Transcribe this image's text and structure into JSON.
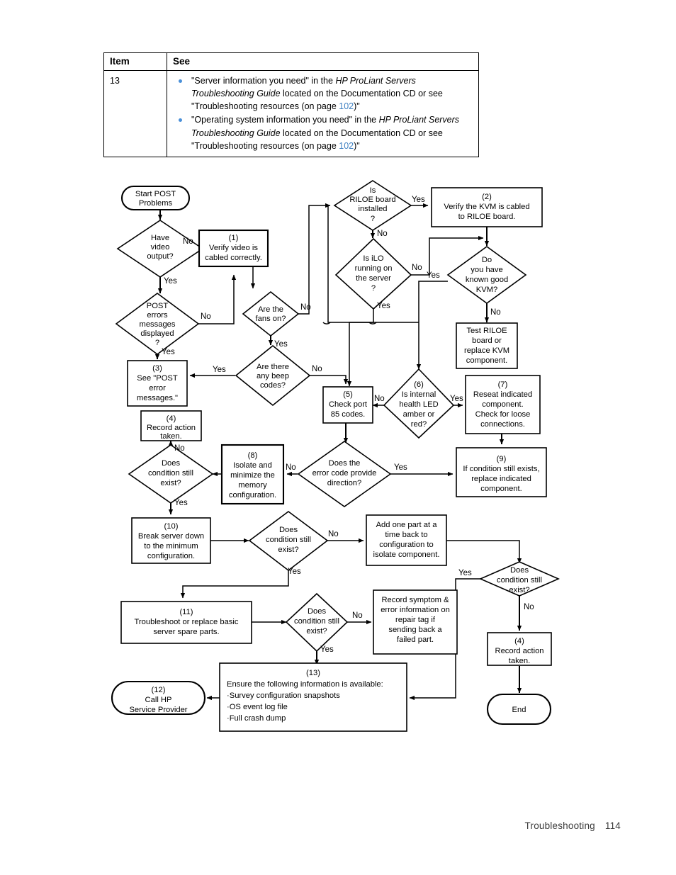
{
  "table": {
    "headers": {
      "item": "Item",
      "see": "See"
    },
    "rows": [
      {
        "item": "13",
        "bullets": [
          {
            "pre": "\"Server information you need\" in the ",
            "italic": "HP ProLiant Servers Troubleshooting Guide",
            "mid": " located on the Documentation CD or see \"Troubleshooting resources (on page ",
            "link": "102",
            "post": ")\""
          },
          {
            "pre": "\"Operating system information you need\" in the ",
            "italic": "HP ProLiant Servers Troubleshooting Guide",
            "mid": " located on the Documentation CD or see \"Troubleshooting resources (on page ",
            "link": "102",
            "post": ")\""
          }
        ]
      }
    ]
  },
  "flowchart": {
    "title": "POST problems troubleshooting flowchart",
    "nodes": {
      "start": {
        "shape": "terminator",
        "lines": [
          "Start POST",
          "Problems"
        ]
      },
      "have_video": {
        "shape": "decision",
        "lines": [
          "Have",
          "video",
          "output?"
        ]
      },
      "post_errors": {
        "shape": "decision",
        "lines": [
          "POST",
          "errors",
          "messages",
          "displayed",
          "?"
        ]
      },
      "box1": {
        "shape": "process",
        "lines": [
          "(1)",
          "Verify video is",
          "cabled correctly."
        ]
      },
      "fans_on": {
        "shape": "decision",
        "lines": [
          "Are the",
          "fans on?"
        ]
      },
      "beep_codes": {
        "shape": "decision",
        "lines": [
          "Are there",
          "any beep",
          "codes?"
        ]
      },
      "box3": {
        "shape": "process",
        "lines": [
          "(3)",
          "See \"POST",
          "error",
          "messages.\""
        ]
      },
      "box4a": {
        "shape": "process",
        "lines": [
          "(4)",
          "Record action",
          "taken."
        ]
      },
      "cond_exist_a": {
        "shape": "decision",
        "lines": [
          "Does",
          "condition still",
          "exist?"
        ]
      },
      "box8": {
        "shape": "process",
        "lines": [
          "(8)",
          "Isolate and",
          "minimize the",
          "memory",
          "configuration."
        ]
      },
      "riloe_installed": {
        "shape": "decision",
        "lines": [
          "Is",
          "RILOE board",
          "installed",
          "?"
        ]
      },
      "ilo_running": {
        "shape": "decision",
        "lines": [
          "Is iLO",
          "running on",
          "the server",
          "?"
        ]
      },
      "box2": {
        "shape": "process",
        "lines": [
          "(2)",
          "Verify the KVM is cabled",
          "to RILOE board."
        ]
      },
      "known_good_kvm": {
        "shape": "decision",
        "lines": [
          "Do",
          "you have",
          "known good",
          "KVM?"
        ]
      },
      "test_riloe": {
        "shape": "process",
        "lines": [
          "Test RILOE",
          "board or",
          "replace KVM",
          "component."
        ]
      },
      "box5": {
        "shape": "process",
        "lines": [
          "(5)",
          "Check port",
          "85 codes."
        ]
      },
      "box6": {
        "shape": "decision",
        "lines": [
          "(6)",
          "Is internal",
          "health LED",
          "amber or",
          "red?"
        ]
      },
      "box7": {
        "shape": "process",
        "lines": [
          "(7)",
          "Reseat indicated",
          "component.",
          "Check for loose",
          "connections."
        ]
      },
      "box9": {
        "shape": "process",
        "lines": [
          "(9)",
          "If condition still exists,",
          "replace indicated",
          "component."
        ]
      },
      "error_code_direction": {
        "shape": "decision",
        "lines": [
          "Does the",
          "error code provide",
          "direction?"
        ]
      },
      "box10": {
        "shape": "process",
        "lines": [
          "(10)",
          "Break server down",
          "to the minimum",
          "configuration."
        ]
      },
      "cond_exist_b": {
        "shape": "decision",
        "lines": [
          "Does",
          "condition still",
          "exist?"
        ]
      },
      "add_one_part": {
        "shape": "process",
        "lines": [
          "Add one part at a",
          "time back to",
          "configuration to",
          "isolate component."
        ]
      },
      "cond_exist_c": {
        "shape": "decision",
        "lines": [
          "Does",
          "condition still",
          "exist?"
        ]
      },
      "box11": {
        "shape": "process",
        "lines": [
          "(11)",
          "Troubleshoot or replace basic",
          "server spare parts."
        ]
      },
      "cond_exist_d": {
        "shape": "decision",
        "lines": [
          "Does",
          "condition still",
          "exist?"
        ]
      },
      "record_symptom": {
        "shape": "process",
        "lines": [
          "Record symptom &",
          "error information on",
          "repair tag if",
          "sending back a",
          "failed part."
        ]
      },
      "box4b": {
        "shape": "process",
        "lines": [
          "(4)",
          "Record action",
          "taken."
        ]
      },
      "box13": {
        "shape": "process",
        "lines": [
          "(13)",
          "Ensure the following information is available:",
          "·Survey configuration snapshots",
          "·OS event log file",
          "·Full crash dump"
        ]
      },
      "box12": {
        "shape": "terminator",
        "lines": [
          "(12)",
          "Call HP",
          "Service Provider"
        ]
      },
      "end": {
        "shape": "terminator",
        "lines": [
          "End"
        ]
      }
    },
    "edge_labels": {
      "have_video_no": "No",
      "have_video_yes": "Yes",
      "post_errors_no": "No",
      "post_errors_yes": "Yes",
      "fans_on_no": "No",
      "fans_on_yes": "Yes",
      "beep_no": "No",
      "beep_yes": "Yes",
      "riloe_yes": "Yes",
      "riloe_no": "No",
      "ilo_no": "No",
      "ilo_yes": "Yes",
      "kvm_yes": "Yes",
      "kvm_no": "No",
      "health_no": "No",
      "health_yes": "Yes",
      "errcode_yes": "Yes",
      "cond_a_no": "No",
      "cond_a_yes": "Yes",
      "cond_b_no": "No",
      "cond_b_yes": "Yes",
      "cond_c_yes": "Yes",
      "cond_c_no": "No",
      "cond_d_no": "No",
      "cond_d_yes": "Yes"
    }
  },
  "footer": {
    "section": "Troubleshooting",
    "page": "114"
  }
}
